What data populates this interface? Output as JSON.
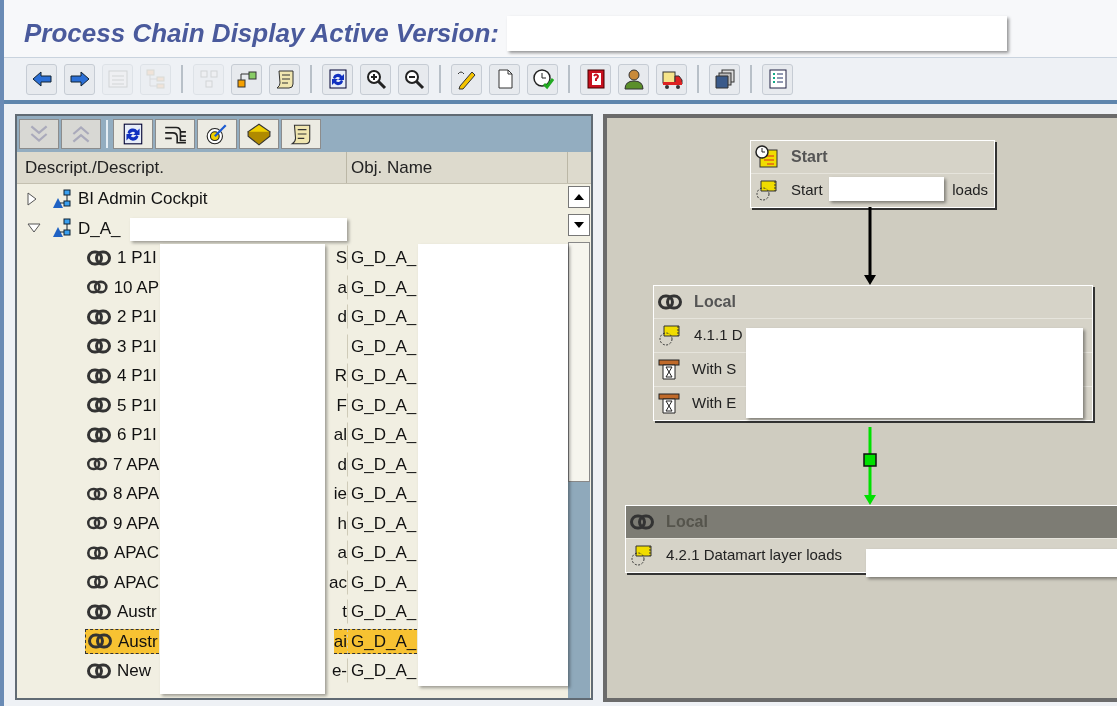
{
  "window": {
    "title": "Process Chain Display Active Version:"
  },
  "toolbar_buttons": [
    {
      "disabled": false
    },
    {
      "disabled": false
    },
    {
      "disabled": true
    },
    {
      "disabled": true
    },
    {
      "disabled": true
    },
    {
      "disabled": false
    },
    {
      "disabled": false
    },
    {
      "disabled": false
    },
    {
      "disabled": false
    },
    {
      "disabled": false
    },
    {
      "disabled": false
    },
    {
      "disabled": false
    },
    {
      "disabled": false
    },
    {
      "disabled": false
    },
    {
      "disabled": false
    },
    {
      "disabled": false
    },
    {
      "disabled": false
    },
    {
      "disabled": false
    }
  ],
  "tree_toolbar_buttons": [
    {
      "disabled": true
    },
    {
      "disabled": true
    },
    {
      "disabled": false
    },
    {
      "disabled": false
    },
    {
      "disabled": false
    },
    {
      "disabled": false
    },
    {
      "disabled": false
    }
  ],
  "tree": {
    "columns": [
      "Descript./Descript.",
      "Obj. Name"
    ],
    "items": [
      {
        "label": "BI Admin Cockpit",
        "expanded": false
      },
      {
        "label": "D_A_",
        "expanded": true,
        "children": [
          {
            "label": "1 P1I",
            "label_tail": "S",
            "obj_name": "G_D_A_",
            "selected": false
          },
          {
            "label": "10 AP",
            "label_tail": "a",
            "obj_name": "G_D_A_",
            "selected": false
          },
          {
            "label": "2 P1I",
            "label_tail": "d",
            "obj_name": "G_D_A_",
            "selected": false
          },
          {
            "label": "3 P1I",
            "obj_name": "G_D_A_",
            "selected": false
          },
          {
            "label": "4 P1I",
            "label_tail": "R",
            "obj_name": "G_D_A_",
            "selected": false
          },
          {
            "label": "5 P1I",
            "label_tail": "F",
            "obj_name": "G_D_A_",
            "selected": false
          },
          {
            "label": "6 P1I",
            "label_tail": "al",
            "obj_name": "G_D_A_",
            "selected": false
          },
          {
            "label": "7 APA",
            "label_tail": "d",
            "obj_name": "G_D_A_",
            "selected": false
          },
          {
            "label": "8 APA",
            "label_tail": "ie",
            "obj_name": "G_D_A_",
            "selected": false
          },
          {
            "label": "9 APA",
            "label_tail": "h",
            "obj_name": "G_D_A_",
            "selected": false
          },
          {
            "label": "APAC",
            "label_tail": "a",
            "obj_name": "G_D_A_",
            "selected": false
          },
          {
            "label": "APAC",
            "label_tail": "ac",
            "obj_name": "G_D_A_",
            "selected": false
          },
          {
            "label": "Austr",
            "label_tail": "t",
            "obj_name": "G_D_A_",
            "selected": false
          },
          {
            "label": "Austr",
            "label_tail": "ai",
            "obj_name": "G_D_A_",
            "selected": true
          },
          {
            "label": "New",
            "label_tail": "e-",
            "obj_name": "G_D_A_",
            "selected": false
          }
        ]
      }
    ]
  },
  "diagram": {
    "nodes": [
      {
        "kind": "start",
        "title": "Start",
        "highlighted": false,
        "rows": [
          {
            "kind": "trigger",
            "text": "Start",
            "tail": "loads"
          }
        ]
      },
      {
        "kind": "chain",
        "title": "Local",
        "highlighted": false,
        "rows": [
          {
            "kind": "trigger",
            "text": "4.1.1 D"
          },
          {
            "kind": "wait",
            "text": "With S"
          },
          {
            "kind": "wait",
            "text": "With E"
          }
        ]
      },
      {
        "kind": "chain",
        "title": "Local",
        "highlighted": true,
        "rows": [
          {
            "kind": "trigger",
            "text": "4.2.1 Datamart layer loads"
          }
        ]
      }
    ],
    "edges": [
      {
        "color": "#000000",
        "status_marker": false
      },
      {
        "color": "#00e000",
        "status_marker": true
      }
    ]
  }
}
